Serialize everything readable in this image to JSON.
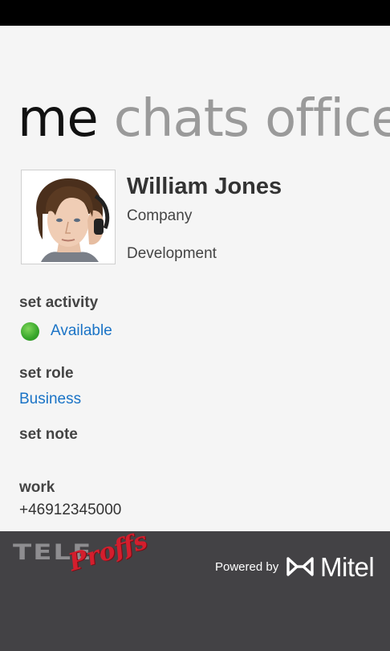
{
  "pivot": {
    "tabs": [
      {
        "label": "me"
      },
      {
        "label": "chats"
      },
      {
        "label": "office"
      }
    ]
  },
  "profile": {
    "name": "William Jones",
    "company": "Company",
    "department": "Development"
  },
  "activity": {
    "heading": "set activity",
    "value": "Available"
  },
  "role": {
    "heading": "set role",
    "value": "Business"
  },
  "note": {
    "heading": "set note"
  },
  "work": {
    "heading": "work",
    "phone": "+46912345000"
  },
  "footer": {
    "brand_text_1": "TELE",
    "brand_text_2": "Proffs",
    "powered_by": "Powered by",
    "partner": "Mitel"
  },
  "colors": {
    "accent": "#1a73c6",
    "footer_bg": "#434245",
    "brand_red": "#d41e2d",
    "status_green": "#36a52a"
  }
}
